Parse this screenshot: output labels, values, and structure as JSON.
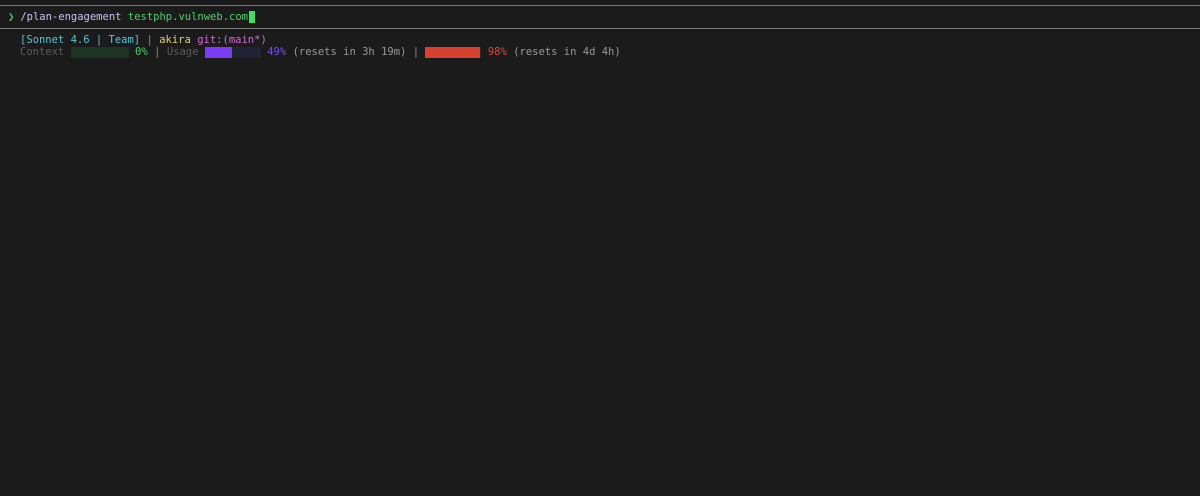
{
  "prompt": {
    "symbol": "❯",
    "command": "/plan-engagement",
    "argument": "testphp.vulnweb.com"
  },
  "status_line": {
    "model_tag": "[Sonnet 4.6 | Team]",
    "separator": "|",
    "user": "akira",
    "git_label": "git:",
    "branch": "(main*)"
  },
  "usage_line": {
    "context_label": "Context",
    "context_percent": "0%",
    "context_fraction": 0.0,
    "separator": "|",
    "usage_label": "Usage",
    "session_percent": "49%",
    "session_fraction": 0.49,
    "session_reset": "(resets in 3h 19m)",
    "weekly_percent": "98%",
    "weekly_fraction": 0.98,
    "weekly_reset": "(resets in 4d 4h)"
  },
  "colors": {
    "background": "#1b1b1b",
    "prompt_green": "#4fd06a",
    "cyan": "#5cc5d8",
    "usage_purple": "#7a3df5",
    "weekly_red": "#d8412f"
  }
}
